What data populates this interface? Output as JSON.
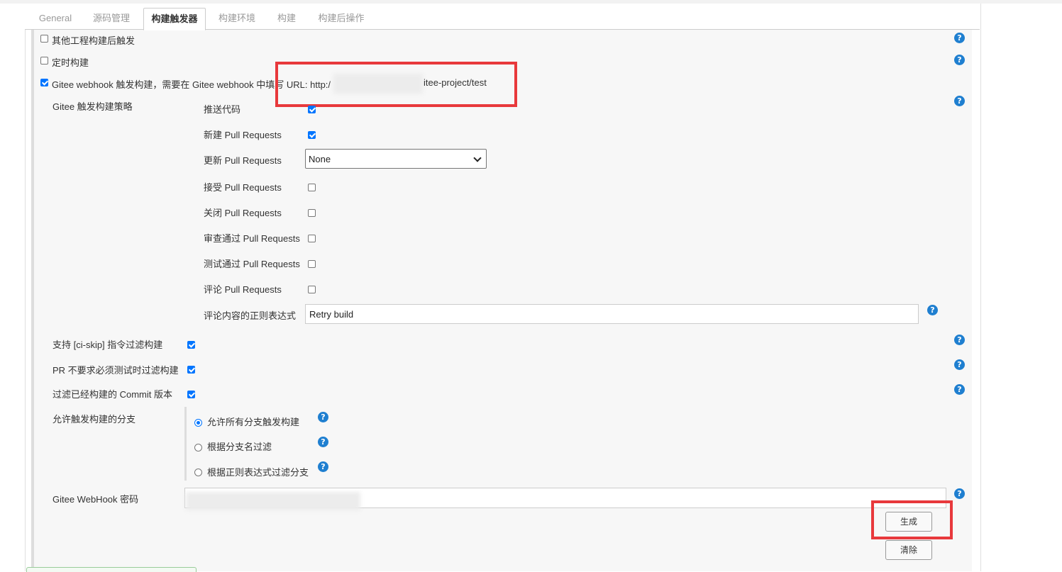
{
  "tabs": [
    "General",
    "源码管理",
    "构建触发器",
    "构建环境",
    "构建",
    "构建后操作"
  ],
  "active_tab_index": 2,
  "triggers": {
    "other_projects_label": "其他工程构建后触发",
    "other_projects_checked": false,
    "scheduled_label": "定时构建",
    "scheduled_checked": false,
    "gitee_webhook_label": "Gitee webhook 触发构建，需要在 Gitee webhook 中填写 URL: http:/",
    "gitee_webhook_url_tail": "itee-project/test",
    "gitee_webhook_checked": true
  },
  "strategy": {
    "title": "Gitee 触发构建策略",
    "items": [
      {
        "label": "推送代码",
        "checked": true
      },
      {
        "label": "新建 Pull Requests",
        "checked": true
      },
      {
        "label": "更新 Pull Requests",
        "type": "select",
        "value": "None"
      },
      {
        "label": "接受 Pull Requests",
        "checked": false
      },
      {
        "label": "关闭 Pull Requests",
        "checked": false
      },
      {
        "label": "审查通过 Pull Requests",
        "checked": false
      },
      {
        "label": "测试通过 Pull Requests",
        "checked": false
      },
      {
        "label": "评论 Pull Requests",
        "checked": false
      }
    ],
    "comment_regex_label": "评论内容的正则表达式",
    "comment_regex_value": "Retry build"
  },
  "options": [
    {
      "label": "支持 [ci-skip] 指令过滤构建",
      "checked": true
    },
    {
      "label": "PR 不要求必须测试时过滤构建",
      "checked": true
    },
    {
      "label": "过滤已经构建的 Commit 版本",
      "checked": true
    }
  ],
  "branches": {
    "label": "允许触发构建的分支",
    "options": [
      {
        "label": "允许所有分支触发构建",
        "selected": true
      },
      {
        "label": "根据分支名过滤",
        "selected": false
      },
      {
        "label": "根据正则表达式过滤分支",
        "selected": false
      }
    ]
  },
  "webhook_password": {
    "label": "Gitee WebHook 密码",
    "generate_button": "生成",
    "clear_button": "清除"
  },
  "help_icon_glyph": "?",
  "colors": {
    "accent": "#0075ff",
    "help": "#1f7fd0",
    "highlight": "#e8393c"
  }
}
